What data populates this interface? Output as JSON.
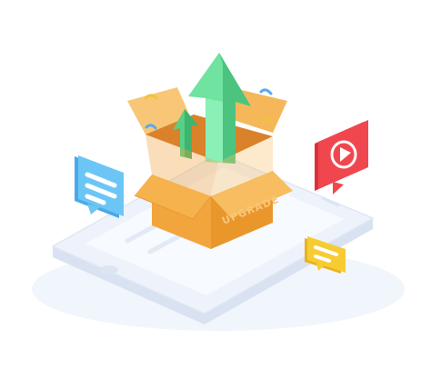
{
  "illustration": {
    "box_label": "UPGRADE",
    "icons": [
      "chat-bubble-icon",
      "play-icon",
      "chat-bubble-icon",
      "upgrade-arrow-icon"
    ],
    "colors": {
      "box": "#f6b24c",
      "box_dark": "#e9962b",
      "arrow": "#5bd88e",
      "chat_blue": "#6cc6f5",
      "play_red": "#f0474f",
      "chat_yellow": "#f7cc33",
      "phone": "#eef3fb"
    }
  }
}
